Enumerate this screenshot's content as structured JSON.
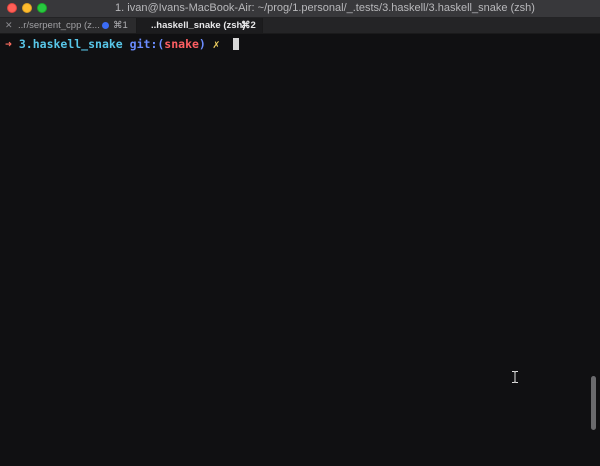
{
  "window": {
    "title": "1. ivan@Ivans-MacBook-Air: ~/prog/1.personal/_.tests/3.haskell/3.haskell_snake (zsh)"
  },
  "tabs": [
    {
      "close_glyph": "✕",
      "label": "..r/serpent_cpp (z...",
      "shortcut": "⌘1",
      "active": false,
      "has_activity_dot": true
    },
    {
      "close_glyph": "✕",
      "label": "..haskell_snake (zsh)",
      "shortcut": "⌘2",
      "active": true
    }
  ],
  "terminal": {
    "prompt": {
      "arrow": "➜",
      "directory": "3.haskell_snake",
      "git_prefix": "git:(",
      "branch": "snake",
      "git_suffix": ")",
      "dirty_marker": "✗"
    }
  },
  "colors": {
    "background": "#101012",
    "prompt_arrow": "#ff6e60",
    "directory": "#58c6e8",
    "git": "#6b8cff",
    "branch": "#ff5f63",
    "dirty": "#f0d060",
    "activity_dot": "#3b6cf6"
  },
  "icons": {
    "traffic_lights": [
      "close-icon",
      "minimize-icon",
      "zoom-icon"
    ],
    "mouse_cursor": "ibeam-cursor-icon"
  }
}
